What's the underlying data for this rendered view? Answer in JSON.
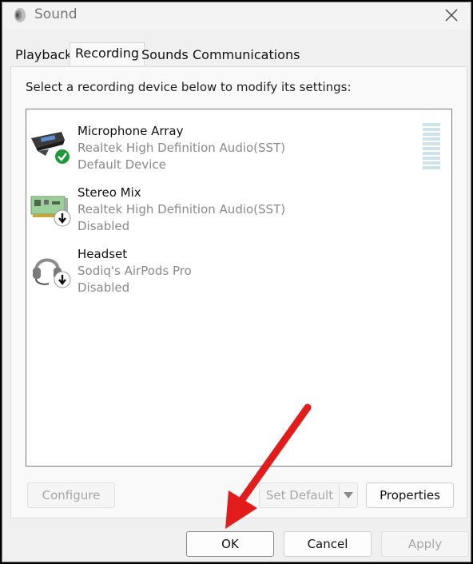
{
  "window": {
    "title": "Sound",
    "app_icon": "speaker-icon",
    "close_icon": "close-icon"
  },
  "tabs": [
    {
      "label": "Playback",
      "active": false
    },
    {
      "label": "Recording",
      "active": true
    },
    {
      "label": "Sounds",
      "active": false
    },
    {
      "label": "Communications",
      "active": false
    }
  ],
  "panel": {
    "instruction": "Select a recording device below to modify its settings:",
    "devices": [
      {
        "name": "Microphone Array",
        "driver": "Realtek High Definition Audio(SST)",
        "status": "Default Device",
        "icon": "microphone-array-icon",
        "badge": "default-check-icon"
      },
      {
        "name": "Stereo Mix",
        "driver": "Realtek High Definition Audio(SST)",
        "status": "Disabled",
        "icon": "sound-card-icon",
        "badge": "disabled-arrow-icon"
      },
      {
        "name": "Headset",
        "driver": "Sodiq's AirPods Pro",
        "status": "Disabled",
        "icon": "headset-icon",
        "badge": "disabled-arrow-icon"
      }
    ],
    "buttons": {
      "configure": "Configure",
      "set_default": "Set Default",
      "properties": "Properties"
    }
  },
  "footer": {
    "ok": "OK",
    "cancel": "Cancel",
    "apply": "Apply"
  },
  "colors": {
    "accent_green": "#1e9a3a",
    "annotation_red": "#e21b1b",
    "disabled_text": "#a6a6a6"
  }
}
